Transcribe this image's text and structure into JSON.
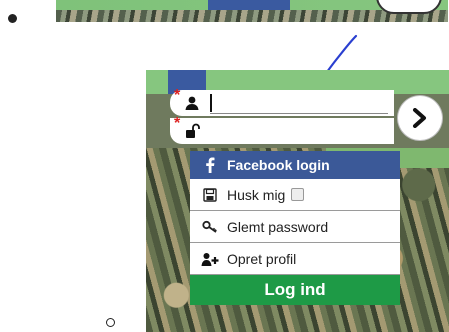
{
  "menu": {
    "facebook_login": "Facebook login",
    "remember_me": "Husk mig",
    "forgot_password": "Glemt password",
    "create_profile": "Opret profil",
    "login_button": "Log ind"
  },
  "form": {
    "username_required_marker": "*",
    "password_required_marker": "*"
  },
  "colors": {
    "facebook_blue": "#3b5998",
    "login_green": "#1e9a46",
    "site_green": "#86c67f",
    "annotation_blue": "#2a3fd0",
    "required_red": "#d22222"
  },
  "icons": {
    "username": "user-icon",
    "password": "unlock-icon",
    "submit": "chevron-right-icon",
    "facebook": "facebook-icon",
    "remember": "save-icon",
    "forgot": "key-icon",
    "create": "add-user-icon"
  }
}
